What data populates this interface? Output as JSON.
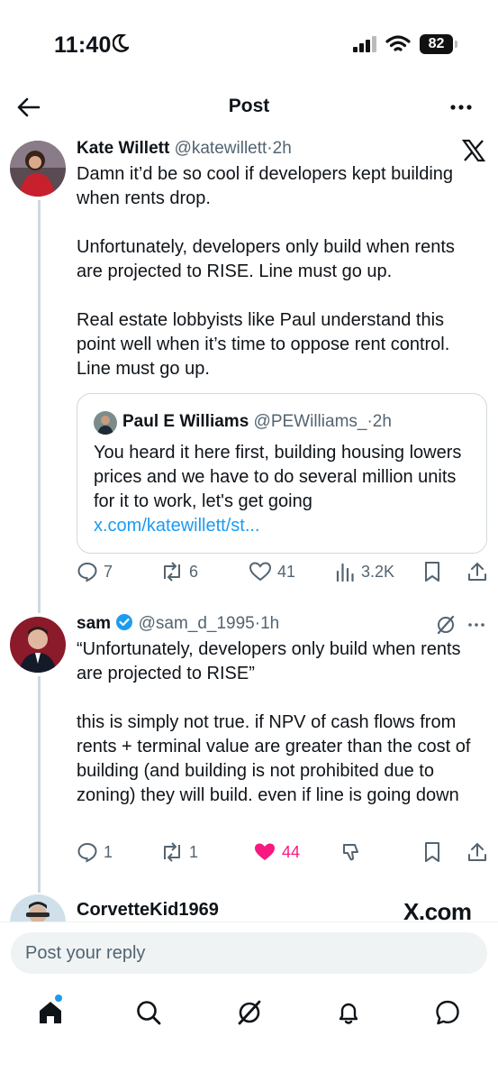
{
  "status": {
    "time": "11:40",
    "battery": "82"
  },
  "nav": {
    "title": "Post"
  },
  "tweets": [
    {
      "name": "Kate Willett",
      "handle": "@katewillett",
      "age": "2h",
      "text": "Damn it’d be so cool if developers kept building when rents drop.\n\nUnfortunately, developers only build when rents are projected to RISE. Line must go up.\n\nReal estate lobbyists like Paul understand this point well when it’s time to oppose rent control. Line must go up.",
      "quote": {
        "name": "Paul E Williams",
        "handle": "@PEWilliams_",
        "age": "2h",
        "text": "You heard it here first, building housing lowers prices and we have to do several million units for it to work, let's get going",
        "link": "x.com/katewillett/st..."
      },
      "stats": {
        "replies": "7",
        "reposts": "6",
        "likes": "41",
        "views": "3.2K"
      }
    },
    {
      "name": "sam",
      "handle": "@sam_d_1995",
      "age": "1h",
      "text": "“Unfortunately, developers only build when rents are projected to RISE”\n\nthis is simply not true. if NPV of cash flows from rents + terminal value are greater than the cost of building (and building is not prohibited due to zoning) they will build. even if line is going down",
      "stats": {
        "replies": "1",
        "reposts": "1",
        "likes": "44"
      }
    },
    {
      "name": "CorvetteKid1969"
    }
  ],
  "watermark": "X.com",
  "composer": {
    "placeholder": "Post your reply"
  },
  "colors": {
    "accent": "#1d9bf0",
    "like": "#f91880",
    "verified": "#1d9bf0"
  },
  "icons": {
    "tab_home": "home-icon",
    "tab_search": "search-icon",
    "tab_grok": "grok-icon",
    "tab_notifications": "bell-icon",
    "tab_messages": "message-icon"
  }
}
